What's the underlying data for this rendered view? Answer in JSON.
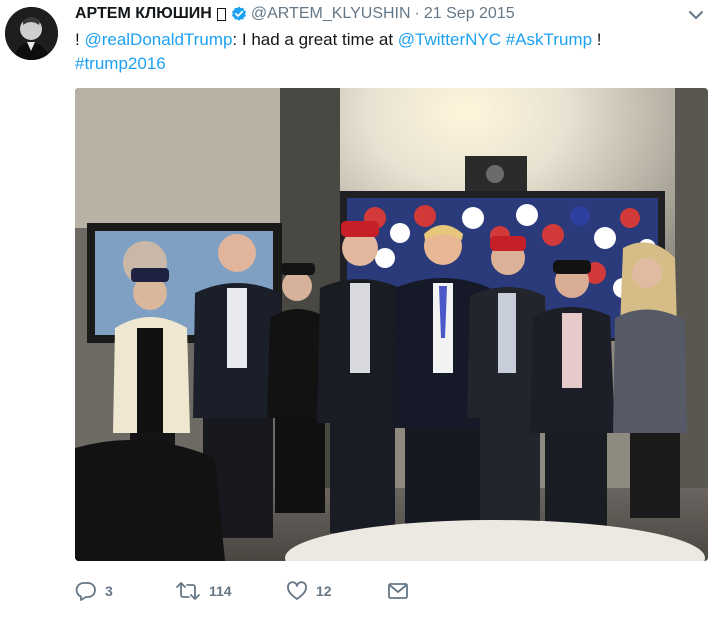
{
  "tweet": {
    "author": {
      "fullname": "АРТЕМ КЛЮШИН",
      "handle": "@ARTEM_KLYUSHIN",
      "verified": true
    },
    "separator": "·",
    "timestamp": "21 Sep 2015",
    "text": {
      "prefix": "! ",
      "mention_1": "@realDonaldTrump",
      "middle": ": I had a great time at ",
      "mention_2": "@TwitterNYC",
      "space": " ",
      "hashtag_1": "#AskTrump",
      "bang": " !",
      "hashtag_2": "#trump2016"
    },
    "actions": {
      "reply_count": "3",
      "retweet_count": "114",
      "like_count": "12"
    }
  },
  "icons": {
    "menu": "chevron-down-icon",
    "verified": "verified-badge-icon",
    "reply": "reply-icon",
    "retweet": "retweet-icon",
    "like": "heart-icon",
    "message": "envelope-icon"
  },
  "colors": {
    "link": "#1da1f2",
    "secondary_text": "#657786",
    "verified": "#1da1f2"
  }
}
